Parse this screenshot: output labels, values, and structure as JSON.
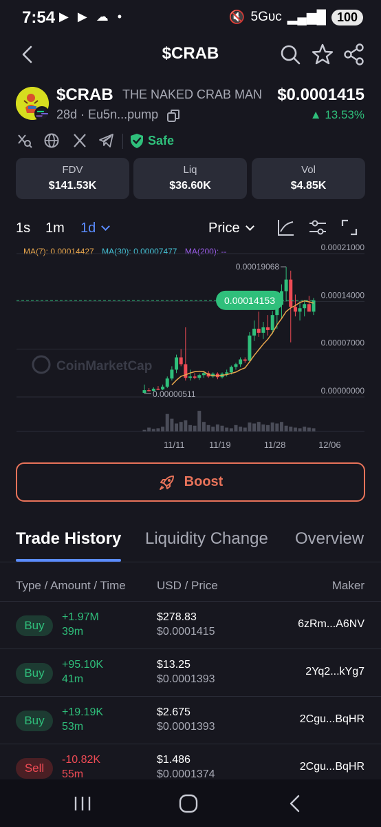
{
  "status_bar": {
    "time": "7:54",
    "network": "5Gᴜᴄ",
    "battery": "100"
  },
  "header": {
    "title": "$CRAB"
  },
  "token": {
    "symbol": "$CRAB",
    "name": "THE NAKED CRAB MAN",
    "age_address": "28d · Eu5n...pump",
    "price": "$0.0001415",
    "change": "▲ 13.53%",
    "safety": "Safe"
  },
  "stats": [
    {
      "label": "FDV",
      "value": "$141.53K"
    },
    {
      "label": "Liq",
      "value": "$36.60K"
    },
    {
      "label": "Vol",
      "value": "$4.85K"
    }
  ],
  "chart_toolbar": {
    "timeframes": [
      "1s",
      "1m",
      "1d"
    ],
    "active_timeframe": "1d",
    "price_select": "Price"
  },
  "chart_data": {
    "type": "candlestick",
    "ma_legend": [
      {
        "label": "MA(7): 0.00014427",
        "color": "#e8a64c"
      },
      {
        "label": "MA(30): 0.00007477",
        "color": "#45c3d6"
      },
      {
        "label": "MA(200): --",
        "color": "#9a5ce8"
      }
    ],
    "y_ticks": [
      "0.00021000",
      "0.00014000",
      "0.00007000",
      "0.00000000"
    ],
    "y_tick_values": [
      0.00021,
      0.00014,
      7e-05,
      0
    ],
    "ylim": [
      0,
      0.00021
    ],
    "x_ticks": [
      "11/11",
      "11/19",
      "11/28",
      "12/06"
    ],
    "high_label": "0.00019068",
    "low_label": "0.00000511",
    "current_price_label": "0.00014153",
    "watermark": "CoinMarketCap",
    "candles": [
      {
        "o": 6e-06,
        "h": 1.8e-05,
        "l": 5.1e-06,
        "c": 1e-05
      },
      {
        "o": 1e-05,
        "h": 1.3e-05,
        "l": 8e-06,
        "c": 9e-06
      },
      {
        "o": 9e-06,
        "h": 1.4e-05,
        "l": 8e-06,
        "c": 1.2e-05
      },
      {
        "o": 1.2e-05,
        "h": 1.6e-05,
        "l": 1e-05,
        "c": 1.1e-05
      },
      {
        "o": 1.1e-05,
        "h": 1.8e-05,
        "l": 1e-05,
        "c": 1.5e-05
      },
      {
        "o": 1.5e-05,
        "h": 3e-05,
        "l": 1.3e-05,
        "c": 2.7e-05
      },
      {
        "o": 2.7e-05,
        "h": 4.5e-05,
        "l": 2.4e-05,
        "c": 4e-05
      },
      {
        "o": 4e-05,
        "h": 6.2e-05,
        "l": 3.5e-05,
        "c": 5.8e-05
      },
      {
        "o": 5.8e-05,
        "h": 7e-05,
        "l": 4.5e-05,
        "c": 4.8e-05
      },
      {
        "o": 4.8e-05,
        "h": 0.000102,
        "l": 2.4e-05,
        "c": 2.8e-05
      },
      {
        "o": 2.8e-05,
        "h": 4e-05,
        "l": 2.4e-05,
        "c": 3e-05
      },
      {
        "o": 3e-05,
        "h": 3.5e-05,
        "l": 2.6e-05,
        "c": 2.8e-05
      },
      {
        "o": 2.8e-05,
        "h": 3.4e-05,
        "l": 2.5e-05,
        "c": 3.2e-05
      },
      {
        "o": 3.2e-05,
        "h": 3.8e-05,
        "l": 2.8e-05,
        "c": 3.5e-05
      },
      {
        "o": 3.5e-05,
        "h": 3.8e-05,
        "l": 2.8e-05,
        "c": 3e-05
      },
      {
        "o": 3e-05,
        "h": 3.6e-05,
        "l": 2.8e-05,
        "c": 3.4e-05
      },
      {
        "o": 3.4e-05,
        "h": 3.6e-05,
        "l": 2.6e-05,
        "c": 2.9e-05
      },
      {
        "o": 2.9e-05,
        "h": 3.6e-05,
        "l": 2.7e-05,
        "c": 3.4e-05
      },
      {
        "o": 3.4e-05,
        "h": 4e-05,
        "l": 3e-05,
        "c": 3.6e-05
      },
      {
        "o": 3.6e-05,
        "h": 4.6e-05,
        "l": 3.3e-05,
        "c": 4.4e-05
      },
      {
        "o": 4.4e-05,
        "h": 5e-05,
        "l": 4e-05,
        "c": 4.8e-05
      },
      {
        "o": 4.8e-05,
        "h": 5.8e-05,
        "l": 4.4e-05,
        "c": 5.5e-05
      },
      {
        "o": 5.5e-05,
        "h": 5.8e-05,
        "l": 5e-05,
        "c": 5.3e-05
      },
      {
        "o": 5.3e-05,
        "h": 9.5e-05,
        "l": 5e-05,
        "c": 9e-05
      },
      {
        "o": 9e-05,
        "h": 0.000112,
        "l": 8.2e-05,
        "c": 0.0001
      },
      {
        "o": 0.0001,
        "h": 0.000125,
        "l": 8.8e-05,
        "c": 9.4e-05
      },
      {
        "o": 9.4e-05,
        "h": 0.00011,
        "l": 8.5e-05,
        "c": 0.000102
      },
      {
        "o": 0.000102,
        "h": 0.00012,
        "l": 9e-05,
        "c": 9.8e-05
      },
      {
        "o": 9.8e-05,
        "h": 0.000126,
        "l": 9.2e-05,
        "c": 0.00012
      },
      {
        "o": 0.00012,
        "h": 0.00014,
        "l": 0.0001,
        "c": 0.000135
      },
      {
        "o": 0.000135,
        "h": 0.000165,
        "l": 0.000115,
        "c": 0.000155
      },
      {
        "o": 0.000155,
        "h": 0.00019068,
        "l": 0.00014,
        "c": 0.000172
      },
      {
        "o": 0.000172,
        "h": 0.000185,
        "l": 8e-05,
        "c": 0.000132
      },
      {
        "o": 0.000132,
        "h": 0.00015,
        "l": 0.000118,
        "c": 0.000125
      },
      {
        "o": 0.000125,
        "h": 0.00014,
        "l": 0.000112,
        "c": 0.00013
      },
      {
        "o": 0.00013,
        "h": 0.000142,
        "l": 0.000118,
        "c": 0.000136
      },
      {
        "o": 0.000136,
        "h": 0.000148,
        "l": 0.000125,
        "c": 0.000125
      },
      {
        "o": 0.000125,
        "h": 0.000145,
        "l": 0.00012,
        "c": 0.00014153
      }
    ],
    "volumes": [
      0.05,
      0.12,
      0.08,
      0.1,
      0.15,
      0.55,
      0.4,
      0.25,
      0.3,
      0.35,
      0.2,
      0.18,
      0.65,
      0.3,
      0.2,
      0.15,
      0.22,
      0.18,
      0.12,
      0.1,
      0.2,
      0.15,
      0.12,
      0.28,
      0.25,
      0.3,
      0.22,
      0.2,
      0.28,
      0.25,
      0.3,
      0.18,
      0.15,
      0.12,
      0.1,
      0.15,
      0.12,
      0.1
    ]
  },
  "boost_label": "Boost",
  "tabs": [
    "Trade History",
    "Liquidity Change",
    "Overview"
  ],
  "trade_header": {
    "col1": "Type / Amount / Time",
    "col2": "USD / Price",
    "col3": "Maker"
  },
  "trades": [
    {
      "type": "Buy",
      "amount": "+1.97M",
      "age": "39m",
      "usd": "$278.83",
      "price": "$0.0001415",
      "maker": "6zRm...A6NV"
    },
    {
      "type": "Buy",
      "amount": "+95.10K",
      "age": "41m",
      "usd": "$13.25",
      "price": "$0.0001393",
      "maker": "2Yq2...kYg7"
    },
    {
      "type": "Buy",
      "amount": "+19.19K",
      "age": "53m",
      "usd": "$2.675",
      "price": "$0.0001393",
      "maker": "2Cgu...BqHR"
    },
    {
      "type": "Sell",
      "amount": "-10.82K",
      "age": "55m",
      "usd": "$1.486",
      "price": "$0.0001374",
      "maker": "2Cgu...BqHR"
    }
  ]
}
